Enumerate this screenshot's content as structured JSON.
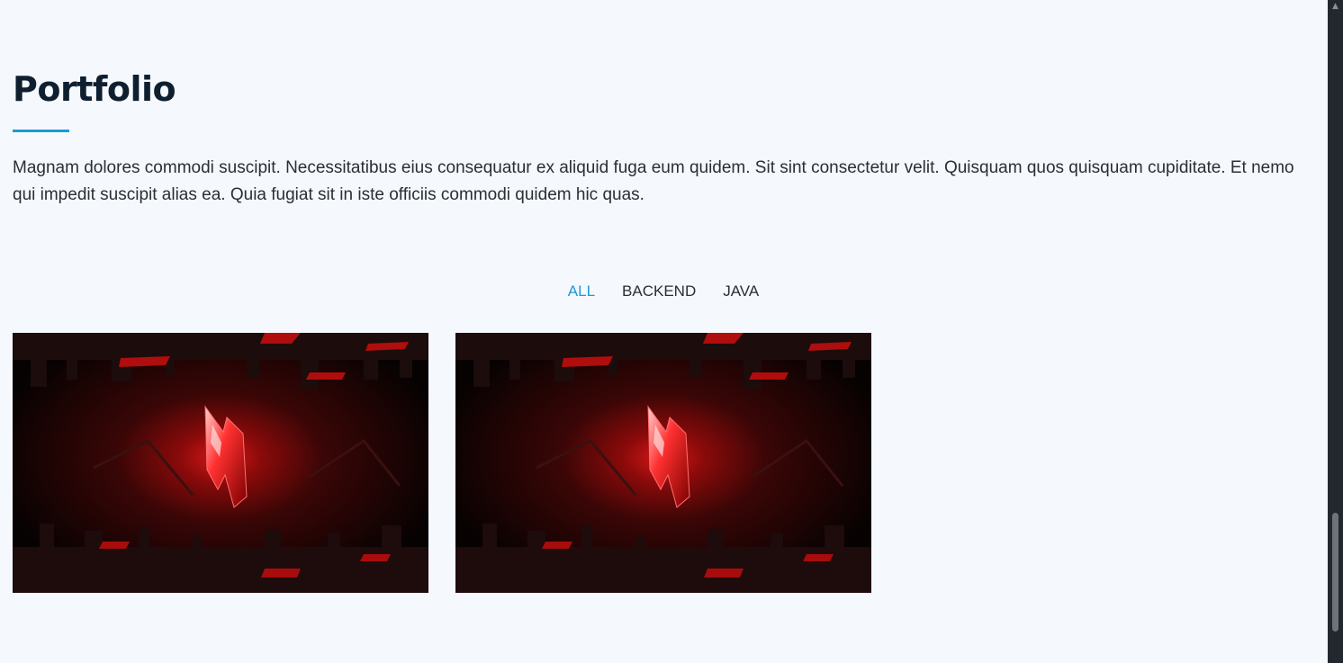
{
  "portfolio": {
    "title": "Portfolio",
    "description": "Magnam dolores commodi suscipit. Necessitatibus eius consequatur ex aliquid fuga eum quidem. Sit sint consectetur velit. Quisquam quos quisquam cupiditate. Et nemo qui impedit suscipit alias ea. Quia fugiat sit in iste officiis commodi quidem hic quas.",
    "accent_color": "#1b9ad8",
    "filters": [
      {
        "label": "ALL",
        "active": true
      },
      {
        "label": "BACKEND",
        "active": false
      },
      {
        "label": "JAVA",
        "active": false
      }
    ],
    "items": [
      {
        "image": "red-glowing-crystal-logo-artwork"
      },
      {
        "image": "red-glowing-crystal-logo-artwork"
      }
    ]
  },
  "scrollbar": {
    "up_icon": "chevron-up-icon"
  }
}
